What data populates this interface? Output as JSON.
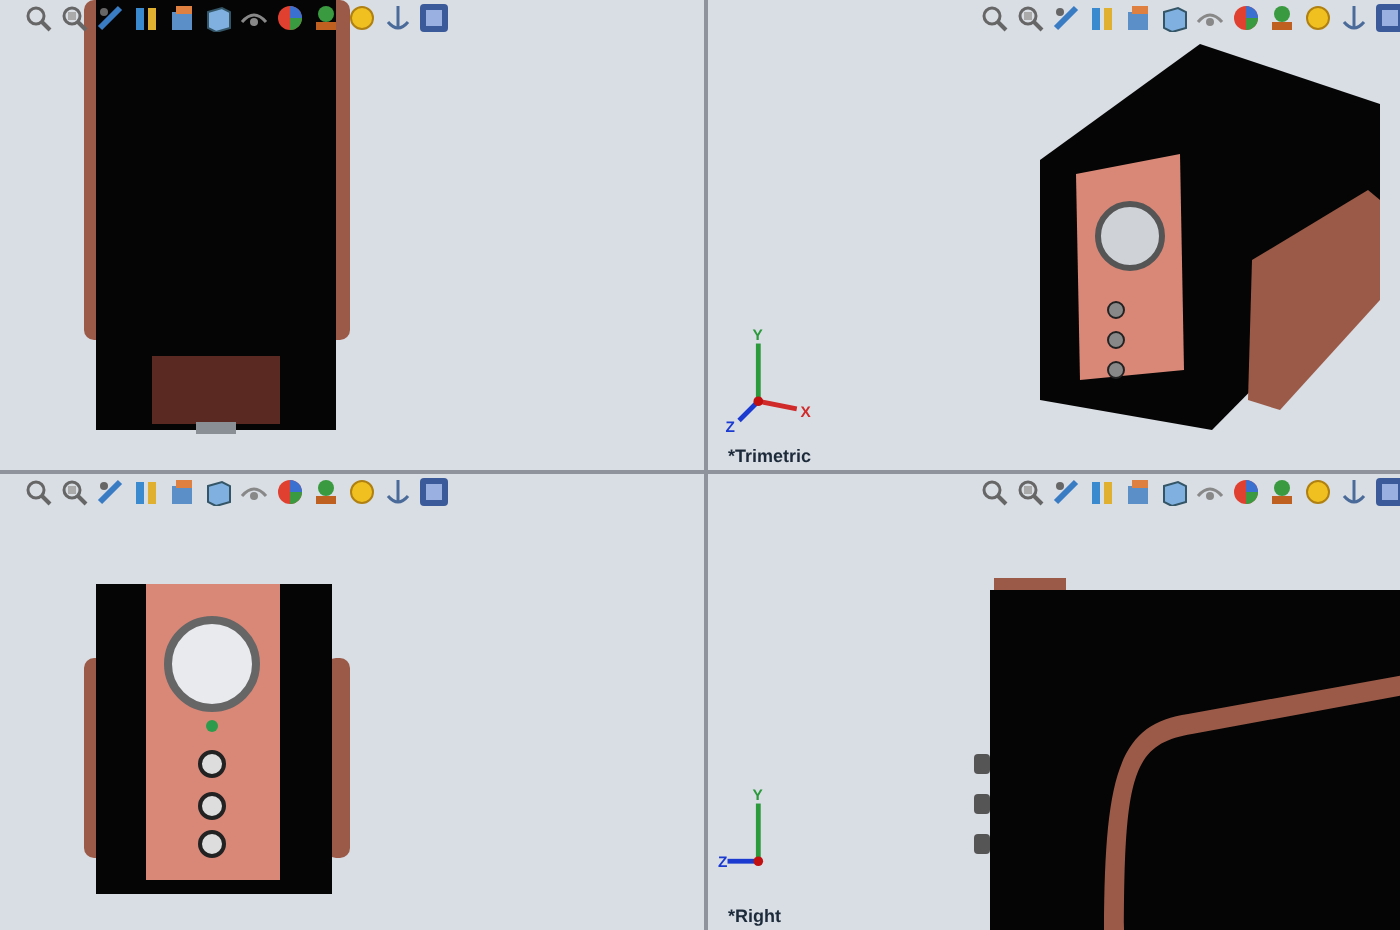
{
  "viewports": [
    {
      "kind": "back"
    },
    {
      "kind": "trimetric",
      "label": "*Trimetric",
      "triad": [
        {
          "kind": "up",
          "label": "Y"
        },
        {
          "kind": "right",
          "label": "X"
        },
        {
          "kind": "left-down",
          "label": "Z"
        }
      ]
    },
    {
      "kind": "front"
    },
    {
      "kind": "right",
      "label": "*Right",
      "triad": [
        {
          "kind": "up",
          "label": "Y"
        },
        {
          "kind": "left",
          "label": "Z"
        }
      ]
    }
  ]
}
